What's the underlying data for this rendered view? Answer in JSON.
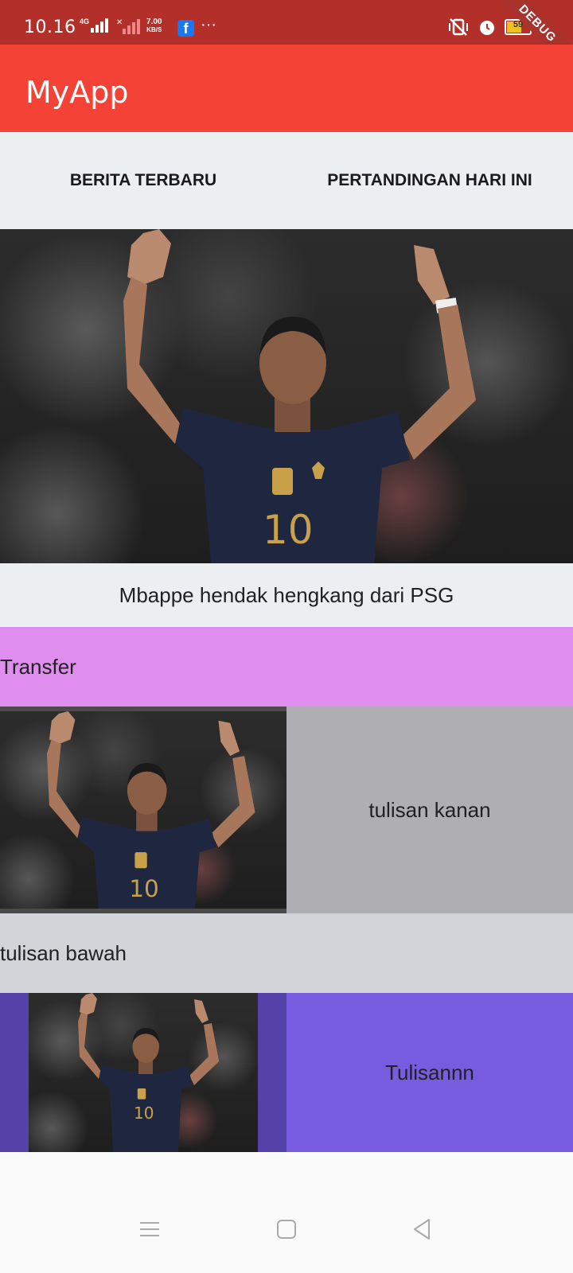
{
  "status_bar": {
    "time": "10.16",
    "signal_1": "4G",
    "net_speed_value": "7.00",
    "net_speed_unit": "KB/S",
    "more": "···",
    "battery_level": "59",
    "debug_banner": "DEBUG",
    "icons": [
      "facebook-icon",
      "vibrate-icon",
      "alarm-icon",
      "battery-icon",
      "charging-icon"
    ]
  },
  "app_bar": {
    "title": "MyApp"
  },
  "tabs": [
    {
      "label": "BERITA TERBARU"
    },
    {
      "label": "PERTANDINGAN HARI INI"
    }
  ],
  "hero": {
    "caption": "Mbappe hendak hengkang dari PSG"
  },
  "transfer": {
    "label": "Transfer"
  },
  "row1": {
    "text": "tulisan kanan"
  },
  "bawah": {
    "label": "tulisan bawah"
  },
  "row2": {
    "text": "Tulisannn"
  },
  "player": {
    "shirt_number": "10"
  },
  "colors": {
    "status_bar": "#b3302a",
    "app_bar": "#f44336",
    "tabs_bg": "#eceff1",
    "transfer_bg": "#e08df0",
    "row1_text_bg": "#afaeb3",
    "bawah_bg": "#d1d5d9",
    "row2_img_bg": "#5542a8",
    "row2_text_bg": "#775ce0"
  }
}
